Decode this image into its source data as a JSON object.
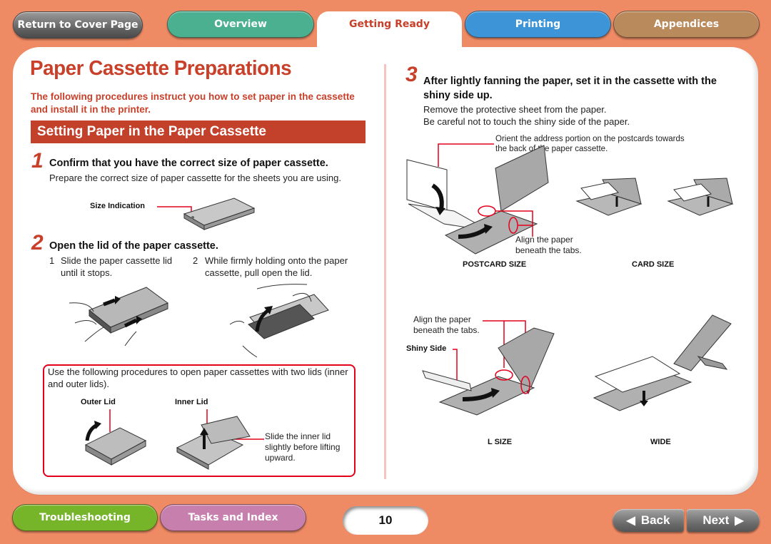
{
  "nav": {
    "return_label": "Return to Cover Page",
    "tabs": [
      {
        "label": "Overview",
        "color": "#4bb090",
        "active": false
      },
      {
        "label": "Getting Ready",
        "color": "#ffffff",
        "active": true
      },
      {
        "label": "Printing",
        "color": "#3d95d8",
        "active": false
      },
      {
        "label": "Appendices",
        "color": "#b98a5c",
        "active": false
      }
    ]
  },
  "page": {
    "title": "Paper Cassette Preparations",
    "intro": "The following procedures instruct you how to set paper in the cassette and install it in the printer.",
    "section_title": "Setting Paper in the Paper Cassette"
  },
  "steps": {
    "s1": {
      "num": "1",
      "title": "Confirm that you have the correct size of paper cassette.",
      "body": "Prepare the correct size of paper cassette for the sheets you are using.",
      "callout": "Size Indication"
    },
    "s2": {
      "num": "2",
      "title": "Open the lid of the paper cassette.",
      "sub1_num": "1",
      "sub1": "Slide the paper cassette lid until it stops.",
      "sub2_num": "2",
      "sub2": "While firmly holding onto the paper cassette, pull open the lid."
    },
    "note": {
      "text": "Use the following procedures to open paper cassettes with two lids (inner and outer lids).",
      "outer_lid": "Outer Lid",
      "inner_lid": "Inner Lid",
      "inner_note": "Slide the inner lid slightly before lifting upward."
    },
    "s3": {
      "num": "3",
      "title": "After lightly fanning the paper, set it in the cassette with the shiny side up.",
      "body1": "Remove the protective sheet from the paper.",
      "body2": "Be careful not to touch the shiny side of the paper.",
      "orient_note": "Orient the address portion on the postcards towards the back of the paper cassette.",
      "align_note": "Align the paper beneath the tabs.",
      "align_note_2": "Align the paper beneath the tabs.",
      "shiny_side": "Shiny Side",
      "captions": {
        "postcard": "POSTCARD SIZE",
        "card": "CARD SIZE",
        "lsize": "L SIZE",
        "wide": "WIDE"
      }
    }
  },
  "footer": {
    "troubleshooting_label": "Troubleshooting",
    "troubleshooting_color": "#76b52a",
    "tasks_label": "Tasks and Index",
    "tasks_color": "#c77fae",
    "page_number": "10",
    "back_label": "Back",
    "next_label": "Next"
  },
  "colors": {
    "background": "#ee8a64",
    "accent_red": "#c8402a",
    "callout_red": "#e4001b"
  }
}
